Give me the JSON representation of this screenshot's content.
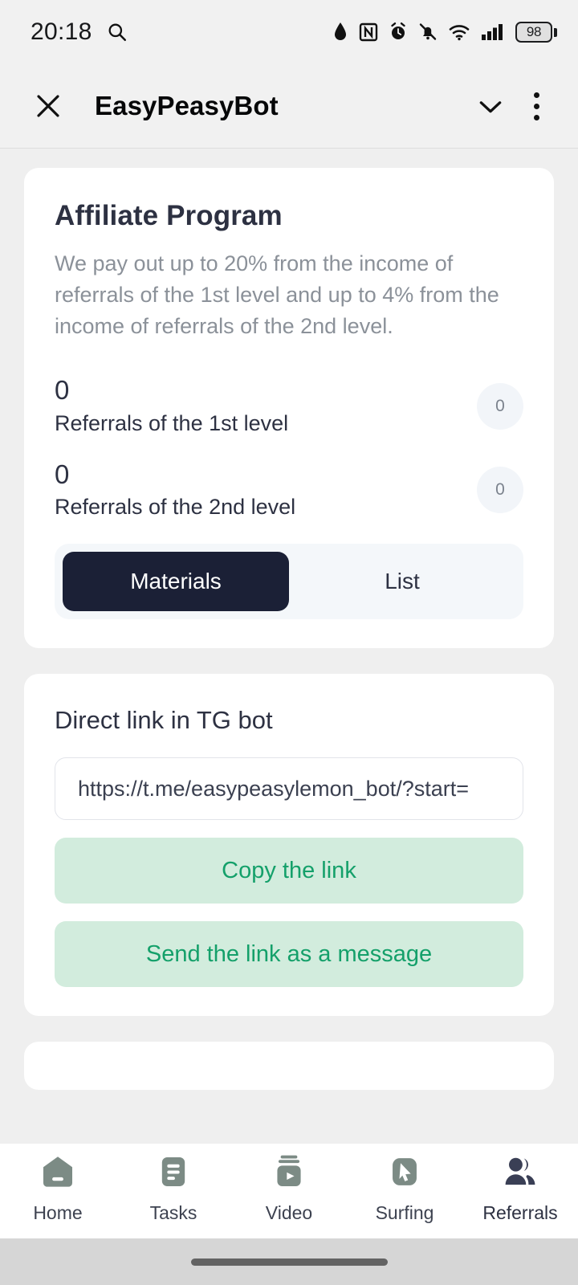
{
  "status_bar": {
    "time": "20:18",
    "search_icon": "search-icon",
    "icons": [
      "water-drop-icon",
      "nfc-icon",
      "alarm-icon",
      "mute-bell-icon",
      "wifi-icon",
      "signal-bars-icon"
    ],
    "battery_level": "98"
  },
  "app_bar": {
    "close_icon": "close-icon",
    "title": "EasyPeasyBot",
    "chevron_icon": "chevron-down-icon",
    "menu_icon": "more-vertical-icon"
  },
  "affiliate_card": {
    "title": "Affiliate Program",
    "description": "We pay out up to 20% from the income of referrals of the 1st level and up to 4% from the income of referrals of the 2nd level.",
    "stats": [
      {
        "value": "0",
        "label": "Referrals of the 1st level",
        "badge": "0"
      },
      {
        "value": "0",
        "label": "Referrals of the 2nd level",
        "badge": "0"
      }
    ],
    "tabs": [
      {
        "label": "Materials",
        "active": true
      },
      {
        "label": "List",
        "active": false
      }
    ]
  },
  "link_card": {
    "title": "Direct link in TG bot",
    "link_value": "https://t.me/easypeasylemon_bot/?start=",
    "copy_label": "Copy the link",
    "send_label": "Send the link as a message"
  },
  "bottom_nav": {
    "items": [
      {
        "label": "Home",
        "icon": "home-icon",
        "active": false
      },
      {
        "label": "Tasks",
        "icon": "tasks-icon",
        "active": false
      },
      {
        "label": "Video",
        "icon": "video-icon",
        "active": false
      },
      {
        "label": "Surfing",
        "icon": "cursor-icon",
        "active": false
      },
      {
        "label": "Referrals",
        "icon": "people-icon",
        "active": true
      }
    ]
  },
  "colors": {
    "accent_green": "#14a06a",
    "green_button_bg": "#d2ecdd",
    "dark_navy": "#1b2036",
    "page_bg": "#efefef",
    "inactive_nav": "#7c8b85"
  }
}
